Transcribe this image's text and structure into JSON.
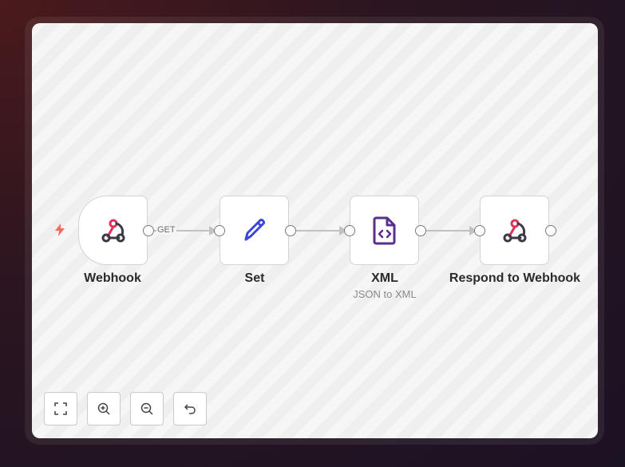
{
  "workflow": {
    "nodes": [
      {
        "id": "webhook",
        "label": "Webhook",
        "subtitle": "",
        "icon": "webhook-icon"
      },
      {
        "id": "set",
        "label": "Set",
        "subtitle": "",
        "icon": "pencil-icon"
      },
      {
        "id": "xml",
        "label": "XML",
        "subtitle": "JSON to XML",
        "icon": "file-code-icon"
      },
      {
        "id": "respond",
        "label": "Respond to Webhook",
        "subtitle": "",
        "icon": "webhook-icon"
      }
    ],
    "edges": [
      {
        "from": "webhook",
        "to": "set",
        "label": "GET"
      },
      {
        "from": "set",
        "to": "xml",
        "label": ""
      },
      {
        "from": "xml",
        "to": "respond",
        "label": ""
      }
    ],
    "trigger_icon": "lightning-bolt-icon"
  },
  "controls": [
    {
      "name": "fit-view",
      "icon": "fullscreen-icon"
    },
    {
      "name": "zoom-in",
      "icon": "zoom-in-icon"
    },
    {
      "name": "zoom-out",
      "icon": "zoom-out-icon"
    },
    {
      "name": "reset-zoom",
      "icon": "undo-icon"
    }
  ],
  "colors": {
    "accent_webhook_pink": "#e0325a",
    "webhook_dark": "#3a3a46",
    "set_blue": "#3b46d6",
    "xml_purple": "#5a2d91",
    "trigger_orange": "#f26b5b",
    "edge_gray": "#c2c2c2"
  }
}
